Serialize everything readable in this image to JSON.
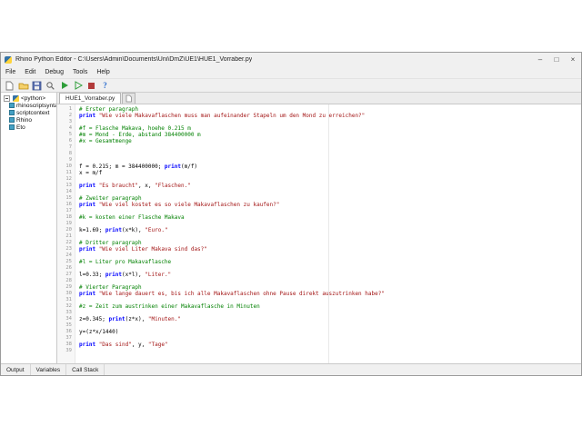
{
  "colors": {
    "comment": "#008000",
    "keyword": "#0000ff",
    "string": "#a31515",
    "run_accent": "#2e9e3a"
  },
  "window": {
    "title": "Rhino Python Editor - C:\\Users\\Admin\\Documents\\Uni\\DmZ\\UE1\\HUE1_Vorraber.py",
    "controls": {
      "minimize": "–",
      "maximize": "□",
      "close": "×"
    }
  },
  "menu": {
    "items": [
      "File",
      "Edit",
      "Debug",
      "Tools",
      "Help"
    ]
  },
  "toolbar": {
    "icons": [
      "new-file-icon",
      "open-folder-icon",
      "save-icon",
      "search-icon",
      "run-icon",
      "debug-run-icon",
      "stop-icon",
      "help-icon"
    ]
  },
  "sidebar": {
    "items": [
      {
        "label": "<python>",
        "depth": 0,
        "expanded": true,
        "icon": "python-node-icon"
      },
      {
        "label": "rhinoscriptsyntax",
        "depth": 1,
        "icon": "module-icon"
      },
      {
        "label": "scriptcontext",
        "depth": 1,
        "icon": "module-icon"
      },
      {
        "label": "Rhino",
        "depth": 1,
        "icon": "module-icon"
      },
      {
        "label": "Eto",
        "depth": 1,
        "icon": "module-icon"
      }
    ]
  },
  "editor": {
    "tab_label": "HUE1_Vorraber.py",
    "lines": [
      [
        [
          "c",
          "# Erster paragraph"
        ]
      ],
      [
        [
          "k",
          "print"
        ],
        [
          "p",
          " "
        ],
        [
          "s",
          "\"Wie viele Makavaflaschen muss man aufeinander Stapeln um den Mond zu erreichen?\""
        ]
      ],
      [],
      [
        [
          "c",
          "#f = Flasche Makava, hoehe 0.215 m"
        ]
      ],
      [
        [
          "c",
          "#m = Mond - Erde, abstand 384400000 m"
        ]
      ],
      [
        [
          "c",
          "#x = Gesamtmenge"
        ]
      ],
      [],
      [],
      [],
      [
        [
          "p",
          "f = 0.215; m = 384400000; "
        ],
        [
          "k",
          "print"
        ],
        [
          "p",
          "(m/f)"
        ]
      ],
      [
        [
          "p",
          "x = m/f"
        ]
      ],
      [],
      [
        [
          "k",
          "print"
        ],
        [
          "p",
          " "
        ],
        [
          "s",
          "\"Es braucht\""
        ],
        [
          "p",
          ", x, "
        ],
        [
          "s",
          "\"Flaschen.\""
        ]
      ],
      [],
      [
        [
          "c",
          "# Zweiter paragraph"
        ]
      ],
      [
        [
          "k",
          "print"
        ],
        [
          "p",
          " "
        ],
        [
          "s",
          "\"Wie viel kostet es so viele Makavaflaschen zu kaufen?\""
        ]
      ],
      [],
      [
        [
          "c",
          "#k = kosten einer Flasche Makava"
        ]
      ],
      [],
      [
        [
          "p",
          "k=1.69; "
        ],
        [
          "k",
          "print"
        ],
        [
          "p",
          "(x*k), "
        ],
        [
          "s",
          "\"Euro.\""
        ]
      ],
      [],
      [
        [
          "c",
          "# Dritter paragraph"
        ]
      ],
      [
        [
          "k",
          "print"
        ],
        [
          "p",
          " "
        ],
        [
          "s",
          "\"Wie viel Liter Makava sind das?\""
        ]
      ],
      [],
      [
        [
          "c",
          "#l = Liter pro Makavaflasche"
        ]
      ],
      [],
      [
        [
          "p",
          "l=0.33; "
        ],
        [
          "k",
          "print"
        ],
        [
          "p",
          "(x*l), "
        ],
        [
          "s",
          "\"Liter.\""
        ]
      ],
      [],
      [
        [
          "c",
          "# Vierter Paragraph"
        ]
      ],
      [
        [
          "k",
          "print"
        ],
        [
          "p",
          " "
        ],
        [
          "s",
          "\"Wie lange dauert es, bis ich alle Makavaflaschen ohne Pause direkt auszutrinken habe?\""
        ]
      ],
      [],
      [
        [
          "c",
          "#z = Zeit zum austrinken einer Makavaflasche in Minuten"
        ]
      ],
      [],
      [
        [
          "p",
          "z=0.345; "
        ],
        [
          "k",
          "print"
        ],
        [
          "p",
          "(z*x), "
        ],
        [
          "s",
          "\"Minuten.\""
        ]
      ],
      [],
      [
        [
          "p",
          "y=(z*x/1440)"
        ]
      ],
      [],
      [
        [
          "k",
          "print"
        ],
        [
          "p",
          " "
        ],
        [
          "s",
          "\"Das sind\""
        ],
        [
          "p",
          ", y, "
        ],
        [
          "s",
          "\"Tage\""
        ]
      ],
      []
    ]
  },
  "panels": {
    "tabs": [
      "Output",
      "Variables",
      "Call Stack"
    ]
  }
}
